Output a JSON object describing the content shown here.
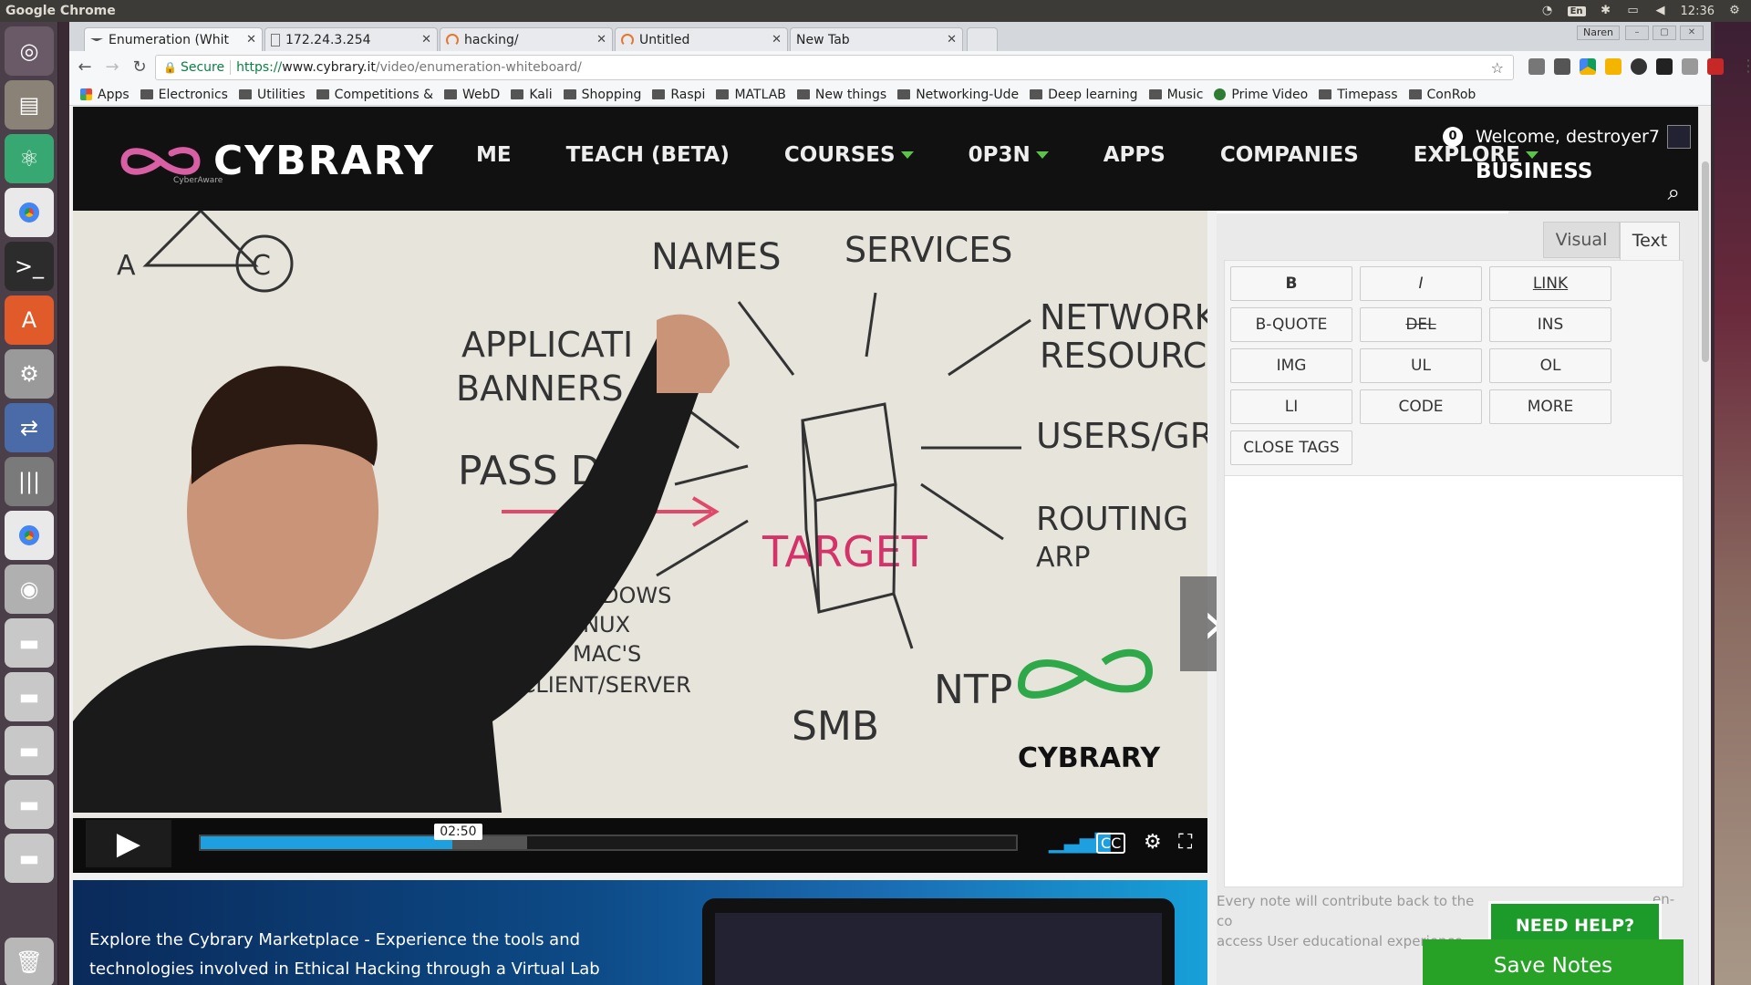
{
  "os": {
    "app_name": "Google Chrome",
    "keyboard": "En",
    "clock": "12:36"
  },
  "browser": {
    "profile": "Naren",
    "tabs": [
      {
        "title": "Enumeration (Whit",
        "active": true
      },
      {
        "title": "172.24.3.254",
        "active": false
      },
      {
        "title": "hacking/",
        "active": false
      },
      {
        "title": "Untitled",
        "active": false
      },
      {
        "title": "New Tab",
        "active": false
      }
    ],
    "url": {
      "secure_label": "Secure",
      "proto": "https://",
      "host": "www.cybrary.it",
      "path": "/video/enumeration-whiteboard/"
    },
    "bookmarks": [
      {
        "label": "Apps",
        "icon": "apps-grid-icon"
      },
      {
        "label": "Electronics",
        "icon": "folder-icon"
      },
      {
        "label": "Utilities",
        "icon": "folder-icon"
      },
      {
        "label": "Competitions &",
        "icon": "folder-icon"
      },
      {
        "label": "WebD",
        "icon": "folder-icon"
      },
      {
        "label": "Kali",
        "icon": "folder-icon"
      },
      {
        "label": "Shopping",
        "icon": "folder-icon"
      },
      {
        "label": "Raspi",
        "icon": "folder-icon"
      },
      {
        "label": "MATLAB",
        "icon": "folder-icon"
      },
      {
        "label": "New things",
        "icon": "folder-icon"
      },
      {
        "label": "Networking-Ude",
        "icon": "folder-icon"
      },
      {
        "label": "Deep learning",
        "icon": "folder-icon"
      },
      {
        "label": "Music",
        "icon": "folder-icon"
      },
      {
        "label": "Prime Video",
        "icon": "prime-video-icon"
      },
      {
        "label": "Timepass",
        "icon": "folder-icon"
      },
      {
        "label": "ConRob",
        "icon": "folder-icon"
      }
    ]
  },
  "site": {
    "logo_text": "CYBRARY",
    "logo_sub": "CyberAware",
    "nav": [
      {
        "label": "ME",
        "dropdown": false
      },
      {
        "label": "TEACH (BETA)",
        "dropdown": false
      },
      {
        "label": "COURSES",
        "dropdown": true
      },
      {
        "label": "0P3N",
        "dropdown": true
      },
      {
        "label": "APPS",
        "dropdown": false
      },
      {
        "label": "COMPANIES",
        "dropdown": false
      },
      {
        "label": "EXPLORE",
        "dropdown": true
      }
    ],
    "notification_count": "0",
    "welcome": "Welcome, destroyer7",
    "business": "BUSINESS",
    "accent_green": "#5cc34a"
  },
  "video": {
    "whiteboard_words": {
      "a": "A",
      "c": "C",
      "names": "NAMES",
      "services": "SERVICES",
      "network_resources_1": "NETWORK",
      "network_resources_2": "RESOURCES",
      "application_1": "APPLICATI",
      "application_2": "BANNERS",
      "passwords": "PASS   DS",
      "users": "USERS/GROU",
      "target": "TARGET",
      "routing": "ROUTING",
      "arp": "ARP",
      "dows": "DOWS",
      "linux": "INUX",
      "macs": "MAC'S",
      "client_server": "-CLIENT/SERVER",
      "smb": "SMB",
      "ntp": "NTP",
      "watermark": "CYBRARY"
    },
    "time": "02:50",
    "progress_fraction": 0.309,
    "buffer_fraction": 0.4
  },
  "banner": {
    "text": "Explore the Cybrary Marketplace - Experience the tools and technologies involved in Ethical Hacking through a Virtual Lab"
  },
  "notes": {
    "tabs": {
      "visual": "Visual",
      "text": "Text"
    },
    "buttons": [
      "B",
      "I",
      "LINK",
      "B-QUOTE",
      "DEL",
      "INS",
      "IMG",
      "UL",
      "OL",
      "LI",
      "CODE",
      "MORE",
      "CLOSE TAGS"
    ],
    "footer": "Every note will contribute back to the co",
    "footer2": "access User educational experience.",
    "footer_tail": "en-",
    "need_help": "NEED HELP?",
    "save": "Save Notes"
  }
}
